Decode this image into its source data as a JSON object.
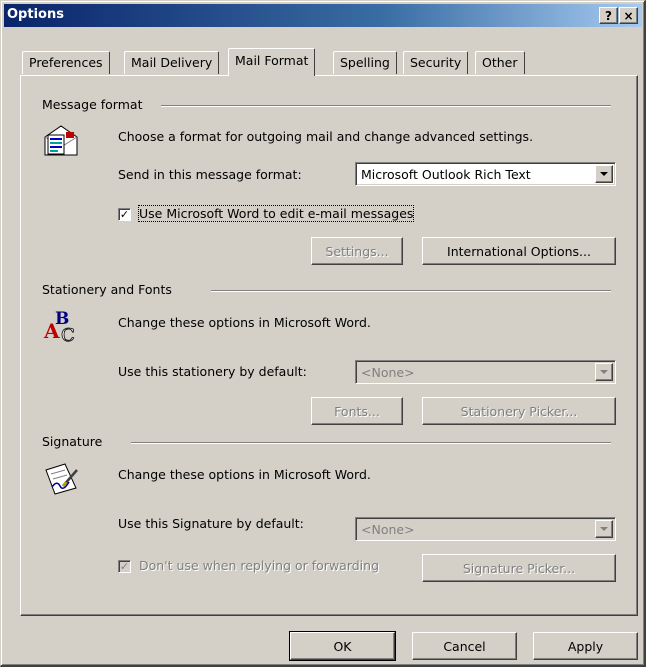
{
  "window": {
    "title": "Options",
    "help_glyph": "?",
    "close_glyph": "×"
  },
  "tabs": [
    "Preferences",
    "Mail Delivery",
    "Mail Format",
    "Spelling",
    "Security",
    "Other"
  ],
  "message_format": {
    "group_label": "Message format",
    "icon": "envelope-document-icon",
    "description": "Choose a format for outgoing mail and change advanced settings.",
    "send_label": "Send in this message format:",
    "send_value": "Microsoft Outlook Rich Text",
    "word_checkbox_label": "Use Microsoft Word to edit e-mail messages",
    "word_checked": true,
    "settings_button": "Settings...",
    "intl_button": "International Options..."
  },
  "stationery": {
    "group_label": "Stationery and Fonts",
    "icon": "fonts-abc-icon",
    "description": "Change these options in Microsoft Word.",
    "stationery_label": "Use this stationery by default:",
    "stationery_value": "<None>",
    "fonts_button": "Fonts...",
    "picker_button": "Stationery Picker..."
  },
  "signature": {
    "group_label": "Signature",
    "icon": "signature-pen-icon",
    "description": "Change these options in Microsoft Word.",
    "signature_label": "Use this Signature by default:",
    "signature_value": "<None>",
    "no_reply_label": "Don't use when replying or forwarding",
    "no_reply_checked": true,
    "picker_button": "Signature Picker..."
  },
  "footer": {
    "ok": "OK",
    "cancel": "Cancel",
    "apply": "Apply"
  },
  "colors": {
    "dialog_face": "#d4d0c8",
    "title_start": "#0a246a",
    "title_end": "#a6caf0"
  }
}
